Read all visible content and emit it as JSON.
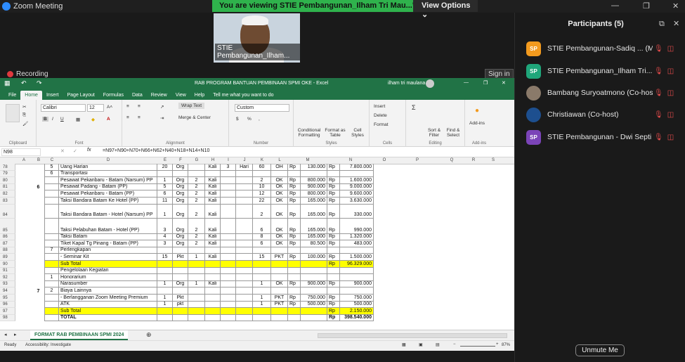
{
  "zoom": {
    "app_title": "Zoom Meeting",
    "share_banner": "You are viewing STIE Pembangunan_Ilham Tri Mau...'s screen",
    "view_options": "View Options",
    "recording": "Recording",
    "video_label": "STIE Pembangunan_Ilham...",
    "sign_in": "Sign in",
    "unmute": "Unmute Me"
  },
  "participants": {
    "title": "Participants (5)",
    "list": [
      {
        "initials": "SP",
        "name": "STIE Pembangunan-Sadiq ... (Me)",
        "color": "#f29a1e"
      },
      {
        "initials": "SP",
        "name": "STIE Pembangunan_Ilham Tri...",
        "color": "#1fa67a"
      },
      {
        "initials": "",
        "name": "Bambang Suryoatmono (Co-host)",
        "color": "#8a7a6a"
      },
      {
        "initials": "",
        "name": "Christiawan (Co-host)",
        "color": "#1d4f8f"
      },
      {
        "initials": "SP",
        "name": "STIE Pembangunan - Dwi Septi H...",
        "color": "#7b44b8"
      }
    ]
  },
  "excel": {
    "title": "RAB PROGRAM BANTUAN PEMBINAAN SPMI OKE  -  Excel",
    "user": "ilham tri maulana",
    "tabs": [
      "File",
      "Home",
      "Insert",
      "Page Layout",
      "Formulas",
      "Data",
      "Review",
      "View",
      "Help",
      "Tell me what you want to do"
    ],
    "font": "Calibri",
    "font_size": "12",
    "number_format": "Custom",
    "wrap_text": "Wrap Text",
    "merge_center": "Merge & Center",
    "conditional": "Conditional Formatting",
    "format_table": "Format as Table",
    "cell_styles": "Cell Styles",
    "insert": "Insert",
    "delete": "Delete",
    "format": "Format",
    "sort": "Sort & Filter",
    "find": "Find & Select",
    "addins": "Add-ins",
    "groups": [
      "Clipboard",
      "Font",
      "Alignment",
      "Number",
      "Styles",
      "Cells",
      "Editing",
      "Add-ins"
    ],
    "name_box": "N98",
    "formula": "=N97+N90+N70+N66+N62+N40+N18+N14+N10",
    "columns": [
      "A",
      "B",
      "C",
      "D",
      "E",
      "F",
      "G",
      "H",
      "I",
      "J",
      "K",
      "L",
      "M",
      "N",
      "O",
      "P",
      "Q",
      "R",
      "S"
    ],
    "sheet_tab": "FORMAT RAB  PEMBINAAN SPMI 2024",
    "status_ready": "Ready",
    "status_access": "Accessibility: Investigate",
    "zoom_level": "87%"
  },
  "rows": [
    {
      "n": "78",
      "b": "",
      "c": "5",
      "d": "Uang Harian",
      "e": "20",
      "f": "Org",
      "g": "",
      "h": "Kali",
      "i": "3",
      "j": "Hari",
      "k": "60",
      "l": "OH",
      "m1": "Rp",
      "m": "130.000",
      "n1": "Rp",
      "nv": "7.800.000"
    },
    {
      "n": "79",
      "b": "",
      "c": "6",
      "d": "Transportasi",
      "e": "",
      "f": "",
      "g": "",
      "h": "",
      "i": "",
      "j": "",
      "k": "",
      "l": "",
      "m1": "",
      "m": "",
      "n1": "",
      "nv": ""
    },
    {
      "n": "80",
      "b": "",
      "c": "",
      "d": "   Pesawat Pekanbaru - Batam (Narsum) PP",
      "e": "1",
      "f": "Org",
      "g": "2",
      "h": "Kali",
      "i": "",
      "j": "",
      "k": "2",
      "l": "OK",
      "m1": "Rp",
      "m": "800.000",
      "n1": "Rp",
      "nv": "1.600.000"
    },
    {
      "n": "81",
      "b": "6",
      "c": "",
      "d": "   Pesawat Padang - Batam (PP)",
      "e": "5",
      "f": "Org",
      "g": "2",
      "h": "Kali",
      "i": "",
      "j": "",
      "k": "10",
      "l": "OK",
      "m1": "Rp",
      "m": "900.000",
      "n1": "Rp",
      "nv": "9.000.000"
    },
    {
      "n": "82",
      "b": "",
      "c": "",
      "d": "   Pesawat Pekanbaru - Batam (PP)",
      "e": "6",
      "f": "Org",
      "g": "2",
      "h": "Kali",
      "i": "",
      "j": "",
      "k": "12",
      "l": "OK",
      "m1": "Rp",
      "m": "800.000",
      "n1": "Rp",
      "nv": "9.600.000"
    },
    {
      "n": "83",
      "b": "",
      "c": "",
      "d": "   Taksi Bandara Batam Ke Hotel (PP)",
      "e": "11",
      "f": "Org",
      "g": "2",
      "h": "Kali",
      "i": "",
      "j": "",
      "k": "22",
      "l": "OK",
      "m1": "Rp",
      "m": "165.000",
      "n1": "Rp",
      "nv": "3.630.000"
    },
    {
      "n": "84",
      "b": "",
      "c": "",
      "d": "   Taksi Bandara Batam - Hotel (Narsum) PP",
      "e": "1",
      "f": "Org",
      "g": "2",
      "h": "Kali",
      "i": "",
      "j": "",
      "k": "2",
      "l": "OK",
      "m1": "Rp",
      "m": "165.000",
      "n1": "Rp",
      "nv": "330.000"
    },
    {
      "n": "85",
      "b": "",
      "c": "",
      "d": "   Taksi Pelabuhan Batam - Hotel (PP)",
      "e": "3",
      "f": "Org",
      "g": "2",
      "h": "Kali",
      "i": "",
      "j": "",
      "k": "6",
      "l": "OK",
      "m1": "Rp",
      "m": "165.000",
      "n1": "Rp",
      "nv": "990.000"
    },
    {
      "n": "86",
      "b": "",
      "c": "",
      "d": "   Taksi Batam",
      "e": "4",
      "f": "Org",
      "g": "2",
      "h": "Kali",
      "i": "",
      "j": "",
      "k": "8",
      "l": "OK",
      "m1": "Rp",
      "m": "165.000",
      "n1": "Rp",
      "nv": "1.320.000"
    },
    {
      "n": "87",
      "b": "",
      "c": "",
      "d": "   Tiket Kapal Tg Pinang - Batam (PP)",
      "e": "3",
      "f": "Org",
      "g": "2",
      "h": "Kali",
      "i": "",
      "j": "",
      "k": "6",
      "l": "OK",
      "m1": "Rp",
      "m": "80.500",
      "n1": "Rp",
      "nv": "483.000"
    },
    {
      "n": "88",
      "b": "",
      "c": "7",
      "d": "Perlengkapan",
      "e": "",
      "f": "",
      "g": "",
      "h": "",
      "i": "",
      "j": "",
      "k": "",
      "l": "",
      "m1": "",
      "m": "",
      "n1": "",
      "nv": ""
    },
    {
      "n": "89",
      "b": "",
      "c": "",
      "d": "   - Seminar Kit",
      "e": "15",
      "f": "Pkt",
      "g": "1",
      "h": "Kali",
      "i": "",
      "j": "",
      "k": "15",
      "l": "PKT",
      "m1": "Rp",
      "m": "100.000",
      "n1": "Rp",
      "nv": "1.500.000"
    },
    {
      "n": "90",
      "b": "",
      "c": "",
      "d": "Sub Total",
      "e": "",
      "f": "",
      "g": "",
      "h": "",
      "i": "",
      "j": "",
      "k": "",
      "l": "",
      "m1": "",
      "m": "",
      "n1": "Rp",
      "nv": "96.329.000",
      "yellow": true
    },
    {
      "n": "91",
      "b": "",
      "c": "",
      "d": "Pengelolaan Kegiatan",
      "e": "",
      "f": "",
      "g": "",
      "h": "",
      "i": "",
      "j": "",
      "k": "",
      "l": "",
      "m1": "",
      "m": "",
      "n1": "",
      "nv": ""
    },
    {
      "n": "92",
      "b": "",
      "c": "1",
      "d": "Honorarium",
      "e": "",
      "f": "",
      "g": "",
      "h": "",
      "i": "",
      "j": "",
      "k": "",
      "l": "",
      "m1": "",
      "m": "",
      "n1": "",
      "nv": ""
    },
    {
      "n": "93",
      "b": "",
      "c": "",
      "d": "   Narasumber",
      "e": "1",
      "f": "Org",
      "g": "1",
      "h": "Kali",
      "i": "",
      "j": "",
      "k": "1",
      "l": "OK",
      "m1": "Rp",
      "m": "900.000",
      "n1": "Rp",
      "nv": "900.000"
    },
    {
      "n": "94",
      "b": "7",
      "c": "2",
      "d": "Biaya Lainnya",
      "e": "",
      "f": "",
      "g": "",
      "h": "",
      "i": "",
      "j": "",
      "k": "",
      "l": "",
      "m1": "",
      "m": "",
      "n1": "",
      "nv": ""
    },
    {
      "n": "95",
      "b": "",
      "c": "",
      "d": "   - Berlangganan Zoom Meeting Premium",
      "e": "1",
      "f": "Pkt",
      "g": "",
      "h": "",
      "i": "",
      "j": "",
      "k": "1",
      "l": "PKT",
      "m1": "Rp",
      "m": "750.000",
      "n1": "Rp",
      "nv": "750.000"
    },
    {
      "n": "96",
      "b": "",
      "c": "",
      "d": "   ATK",
      "e": "1",
      "f": "pkt",
      "g": "",
      "h": "",
      "i": "",
      "j": "",
      "k": "1",
      "l": "PKT",
      "m1": "Rp",
      "m": "500.000",
      "n1": "Rp",
      "nv": "500.000"
    },
    {
      "n": "97",
      "b": "",
      "c": "",
      "d": "Sub Total",
      "e": "",
      "f": "",
      "g": "",
      "h": "",
      "i": "",
      "j": "",
      "k": "",
      "l": "",
      "m1": "",
      "m": "",
      "n1": "Rp",
      "nv": "2.150.000",
      "yellow": true
    },
    {
      "n": "98",
      "b": "",
      "c": "",
      "d": "TOTAL",
      "e": "",
      "f": "",
      "g": "",
      "h": "",
      "i": "",
      "j": "",
      "k": "",
      "l": "",
      "m1": "",
      "m": "",
      "n1": "Rp",
      "nv": "398.540.000",
      "bold": true
    }
  ]
}
